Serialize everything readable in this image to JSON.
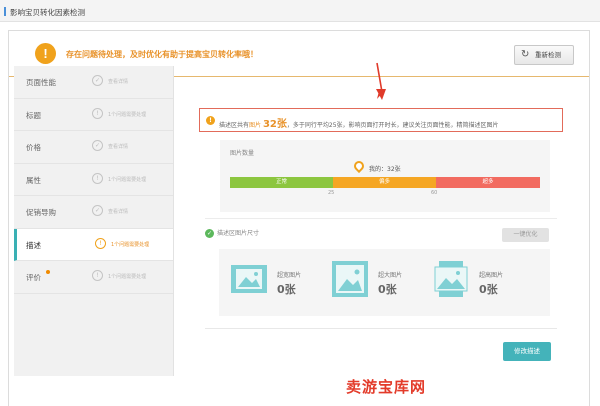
{
  "header": {
    "title": "影响宝贝转化因素检测"
  },
  "alert": {
    "icon": "warning-icon",
    "text": "存在问题待处理，及时优化有助于提高宝贝转化率哦！",
    "recheck_label": "重新检测"
  },
  "sidebar": {
    "items": [
      {
        "label": "页面性能",
        "status": "查看详情",
        "status_icon": "check-icon",
        "active": false
      },
      {
        "label": "标题",
        "status": "1个问题需要处理",
        "status_icon": "warning-icon",
        "active": false
      },
      {
        "label": "价格",
        "status": "查看详情",
        "status_icon": "check-icon",
        "active": false
      },
      {
        "label": "属性",
        "status": "1个问题需要处理",
        "status_icon": "warning-icon",
        "active": false
      },
      {
        "label": "促销导购",
        "status": "查看详情",
        "status_icon": "check-icon",
        "active": false
      },
      {
        "label": "描述",
        "status": "1个问题需要处理",
        "status_icon": "warning-icon",
        "active": true
      },
      {
        "label": "评价",
        "status": "1个问题需要处理",
        "status_icon": "warning-icon",
        "active": false
      }
    ]
  },
  "info": {
    "prefix": "描述区共有",
    "mid": "图片",
    "count": "32张",
    "suffix": "，多于同行平均25张，影响页面打开时长，建议关注页面性能，精简描述区图片"
  },
  "image_count": {
    "heading": "图片数量",
    "mine_label": "我的：",
    "mine_value": "32张",
    "segments": [
      {
        "label": "正常",
        "color": "#8cc63f"
      },
      {
        "label": "偏多",
        "color": "#f5a623"
      },
      {
        "label": "超多",
        "color": "#f26b60"
      }
    ],
    "ticks": [
      "25",
      "60"
    ]
  },
  "image_size": {
    "heading": "描述区图片尺寸",
    "optimize_label": "一键优化",
    "items": [
      {
        "label": "超宽图片",
        "count": "0张",
        "icon": "wide-image-icon"
      },
      {
        "label": "超大图片",
        "count": "0张",
        "icon": "large-image-icon"
      },
      {
        "label": "超高图片",
        "count": "0张",
        "icon": "tall-image-icon"
      }
    ]
  },
  "actions": {
    "edit_label": "修改描述"
  },
  "watermark": "卖游宝库网"
}
